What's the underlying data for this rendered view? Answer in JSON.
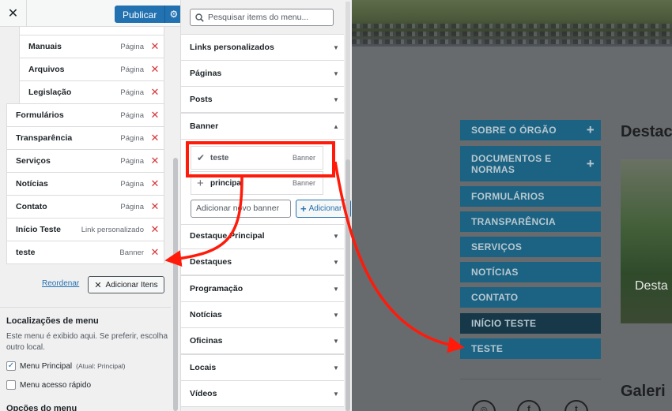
{
  "topbar": {
    "publish_label": "Publicar"
  },
  "menu_items": [
    {
      "label": "Manuais",
      "kind": "Página",
      "sub": true
    },
    {
      "label": "Arquivos",
      "kind": "Página",
      "sub": true
    },
    {
      "label": "Legislação",
      "kind": "Página",
      "sub": true
    },
    {
      "label": "Formulários",
      "kind": "Página",
      "sub": false
    },
    {
      "label": "Transparência",
      "kind": "Página",
      "sub": false
    },
    {
      "label": "Serviços",
      "kind": "Página",
      "sub": false
    },
    {
      "label": "Notícias",
      "kind": "Página",
      "sub": false
    },
    {
      "label": "Contato",
      "kind": "Página",
      "sub": false
    },
    {
      "label": "Início Teste",
      "kind": "Link personalizado",
      "sub": false
    },
    {
      "label": "teste",
      "kind": "Banner",
      "sub": false
    }
  ],
  "actions": {
    "reorder": "Reordenar",
    "add_items": "Adicionar Itens"
  },
  "locations": {
    "title": "Localizações de menu",
    "description": "Este menu é exibido aqui. Se preferir, escolha outro local.",
    "options": [
      {
        "label": "Menu Principal",
        "note": "(Atual: Principal)",
        "checked": true
      },
      {
        "label": "Menu acesso rápido",
        "note": "",
        "checked": false
      }
    ]
  },
  "menu_options_title": "Opções do menu",
  "add_panel": {
    "search_placeholder": "Pesquisar items do menu...",
    "sections": [
      "Links personalizados",
      "Páginas",
      "Posts",
      "Banner",
      "Destaque Principal",
      "Destaques",
      "Programação",
      "Notícias",
      "Oficinas",
      "Locais",
      "Vídeos"
    ],
    "expanded_section": "Banner",
    "banner_items": [
      {
        "label": "teste",
        "kind": "Banner",
        "added": true
      },
      {
        "label": "principal",
        "kind": "Banner",
        "added": false
      }
    ],
    "new_banner_placeholder": "Adicionar novo banner",
    "add_new_label": "Adicionar"
  },
  "preview": {
    "nav": [
      "SOBRE O ÓRGÃO",
      "DOCUMENTOS E NORMAS",
      "FORMULÁRIOS",
      "TRANSPARÊNCIA",
      "SERVIÇOS",
      "NOTÍCIAS",
      "CONTATO",
      "INÍCIO TESTE",
      "TESTE"
    ],
    "heading_1": "Destac",
    "image_caption": "Desta",
    "heading_2": "Galeri",
    "social_icons": [
      "instagram-icon",
      "facebook-icon",
      "twitter-icon"
    ]
  },
  "colors": {
    "primary": "#2271b1",
    "delete": "#d63638",
    "nav_bg": "#1c6282",
    "nav_active": "#173848",
    "annotation": "#ff1a0a"
  }
}
